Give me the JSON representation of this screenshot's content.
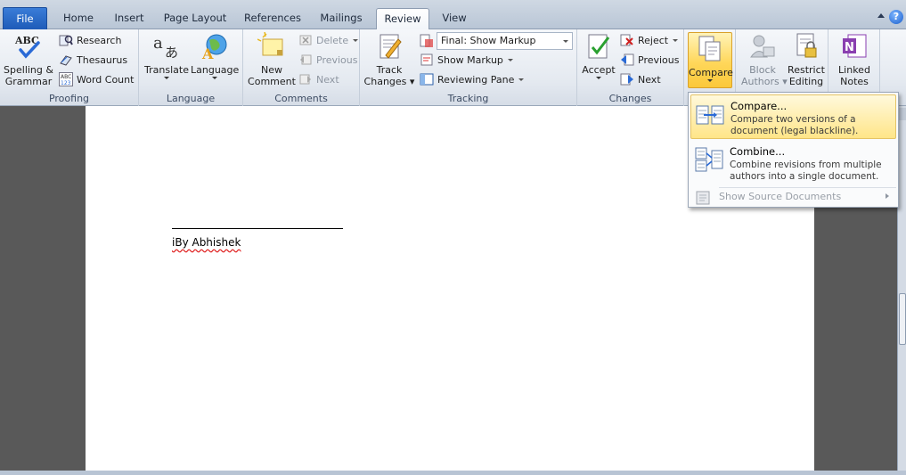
{
  "tabs": [
    "File",
    "Home",
    "Insert",
    "Page Layout",
    "References",
    "Mailings",
    "Review",
    "View"
  ],
  "help": {
    "label": "?"
  },
  "ribbon": {
    "proofing": {
      "label": "Proofing",
      "spelling": [
        "Spelling &",
        "Grammar"
      ],
      "research": "Research",
      "thesaurus": "Thesaurus",
      "word_count": "Word Count"
    },
    "language": {
      "label": "Language",
      "translate": "Translate",
      "language": "Language"
    },
    "comments": {
      "label": "Comments",
      "new_comment": [
        "New",
        "Comment"
      ],
      "delete": "Delete",
      "previous": "Previous",
      "next": "Next"
    },
    "tracking": {
      "label": "Tracking",
      "track_changes": [
        "Track",
        "Changes"
      ],
      "display_combo": "Final: Show Markup",
      "show_markup": "Show Markup",
      "reviewing_pane": "Reviewing Pane"
    },
    "changes": {
      "label": "Changes",
      "accept": "Accept",
      "reject": "Reject",
      "previous": "Previous",
      "next": "Next"
    },
    "compare": {
      "label": "Compare"
    },
    "protect": {
      "block_authors": [
        "Block",
        "Authors"
      ],
      "restrict_editing": [
        "Restrict",
        "Editing"
      ]
    },
    "onenote": {
      "linked_notes": [
        "Linked",
        "Notes"
      ]
    }
  },
  "document": {
    "byline": "iBy Abhishek"
  },
  "compare_menu": {
    "compare": {
      "title": "Compare...",
      "desc": [
        "Compare two versions of a",
        "document (legal blackline)."
      ]
    },
    "combine": {
      "title": "Combine...",
      "desc": [
        "Combine revisions from multiple",
        "authors into a single document."
      ]
    },
    "show_source": {
      "title": "Show Source Documents"
    }
  },
  "colors": {
    "file_tab": "#1e5bb8",
    "highlight": "#ffd75a",
    "page": "#ffffff",
    "workspace": "#595959"
  }
}
